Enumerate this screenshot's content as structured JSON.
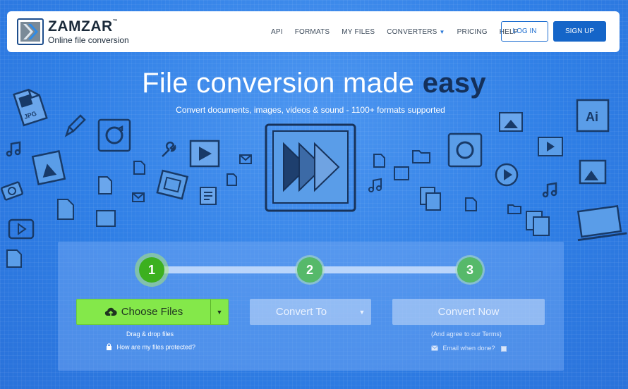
{
  "header": {
    "logo": {
      "name": "ZAMZAR",
      "trademark": "™",
      "tagline": "Online file conversion"
    },
    "nav": [
      {
        "label": "API"
      },
      {
        "label": "FORMATS"
      },
      {
        "label": "MY FILES"
      },
      {
        "label": "CONVERTERS",
        "has_dropdown": true
      },
      {
        "label": "PRICING"
      },
      {
        "label": "HELP"
      }
    ],
    "login_label": "LOG IN",
    "signup_label": "SIGN UP"
  },
  "hero": {
    "title_main": "File conversion made ",
    "title_emphasis": "easy",
    "subtitle": "Convert documents, images, videos & sound - 1100+ formats supported"
  },
  "converter": {
    "steps": [
      "1",
      "2",
      "3"
    ],
    "choose_files_label": "Choose Files",
    "drag_drop_text": "Drag & drop files",
    "protected_link": "How are my files protected?",
    "convert_to_label": "Convert To",
    "convert_now_label": "Convert Now",
    "agree_text": "(And agree to our ",
    "terms_link": "Terms",
    "agree_close": ")",
    "email_label": "Email when done?"
  },
  "colors": {
    "background": "#2f7fe6",
    "signup_button": "#1565c8",
    "choose_files": "#84e84a",
    "step_active": "#3cb01f",
    "title_emphasis": "#14305a"
  },
  "icons": [
    "upload-cloud-icon",
    "lock-icon",
    "envelope-icon",
    "caret-down-icon",
    "play-forward-icon",
    "jpg-file-icon",
    "music-note-icon",
    "pencil-icon",
    "refresh-icon",
    "wrench-icon",
    "folder-icon",
    "ai-file-icon",
    "camera-icon",
    "laptop-icon",
    "video-icon"
  ]
}
